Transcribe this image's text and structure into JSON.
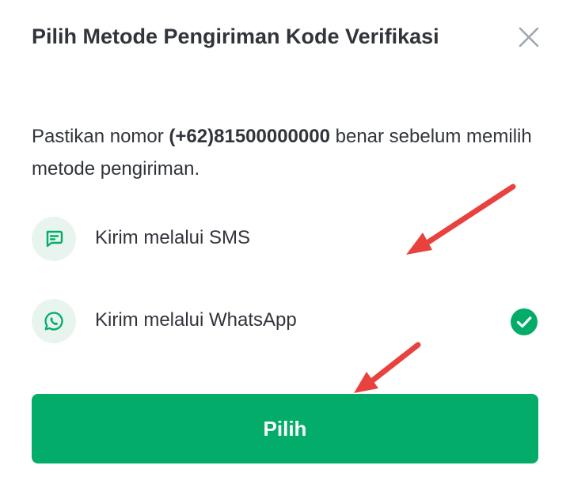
{
  "dialog": {
    "title": "Pilih Metode Pengiriman Kode Verifikasi",
    "description_prefix": "Pastikan nomor ",
    "phone_number": "(+62)81500000000",
    "description_suffix": " benar sebelum memilih metode pengiriman.",
    "close_icon": "close-icon"
  },
  "options": [
    {
      "label": "Kirim melalui SMS",
      "icon": "sms-icon",
      "selected": false
    },
    {
      "label": "Kirim melalui WhatsApp",
      "icon": "whatsapp-icon",
      "selected": true
    }
  ],
  "primary_button": {
    "label": "Pilih"
  },
  "colors": {
    "accent": "#03ac69",
    "icon_bg": "#e8f5ef",
    "text": "#31353b",
    "annotation_arrow": "#e8423f"
  }
}
